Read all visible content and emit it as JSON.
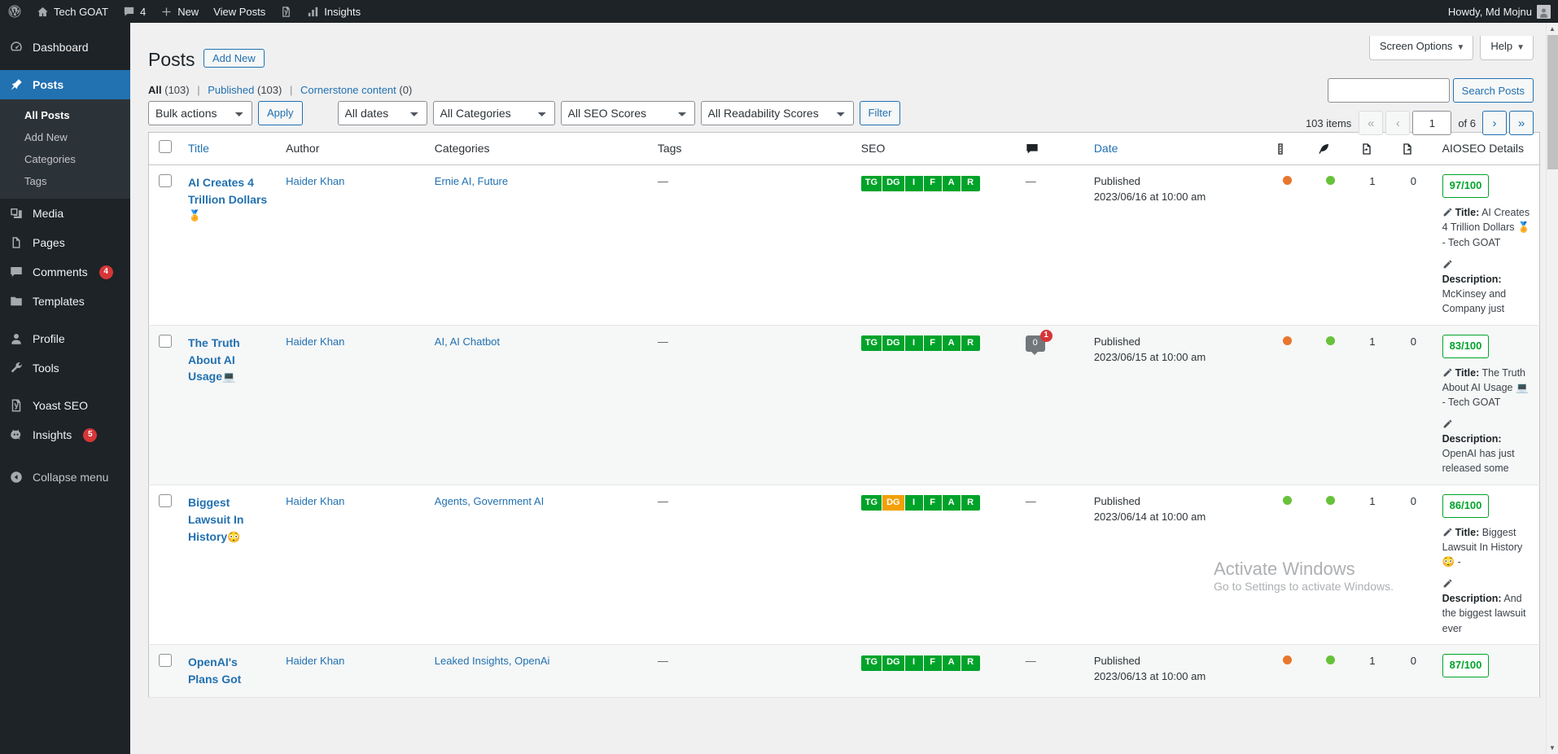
{
  "adminbar": {
    "logo_icon": "wordpress-icon",
    "site_icon": "home-icon",
    "site_name": "Tech GOAT",
    "comments_icon": "comment-icon",
    "comments_count": "4",
    "new_icon": "plus-icon",
    "new_label": "New",
    "view_posts_label": "View Posts",
    "yoast_icon": "yoast-icon",
    "insights_icon": "bar-chart-icon",
    "insights_label": "Insights",
    "howdy": "Howdy, Md Mojnu",
    "avatar_icon": "avatar-icon"
  },
  "sidebar": {
    "items": [
      {
        "label": "Dashboard",
        "icon": "dashboard-icon",
        "current": false
      },
      {
        "label": "Posts",
        "icon": "pin-icon",
        "current": true
      },
      {
        "label": "Media",
        "icon": "media-icon",
        "current": false
      },
      {
        "label": "Pages",
        "icon": "pages-icon",
        "current": false
      },
      {
        "label": "Comments",
        "icon": "comment-icon",
        "current": false,
        "badge": "4"
      },
      {
        "label": "Templates",
        "icon": "folder-icon",
        "current": false
      },
      {
        "label": "Profile",
        "icon": "user-icon",
        "current": false
      },
      {
        "label": "Tools",
        "icon": "wrench-icon",
        "current": false
      },
      {
        "label": "Yoast SEO",
        "icon": "yoast-icon",
        "current": false
      },
      {
        "label": "Insights",
        "icon": "monsterinsights-icon",
        "current": false,
        "badge": "5"
      }
    ],
    "submenu": [
      {
        "label": "All Posts",
        "current": true
      },
      {
        "label": "Add New",
        "current": false
      },
      {
        "label": "Categories",
        "current": false
      },
      {
        "label": "Tags",
        "current": false
      }
    ],
    "collapse_label": "Collapse menu",
    "collapse_icon": "collapse-arrow-icon"
  },
  "screen_meta": {
    "screen_options": "Screen Options",
    "help": "Help",
    "caret": "▼"
  },
  "header": {
    "title": "Posts",
    "add_new": "Add New"
  },
  "views": {
    "all_label": "All",
    "all_count": "(103)",
    "published_label": "Published",
    "published_count": "(103)",
    "cornerstone_label": "Cornerstone content",
    "cornerstone_count": "(0)",
    "separator": "|"
  },
  "filters": {
    "bulk_actions": "Bulk actions",
    "apply": "Apply",
    "all_dates": "All dates",
    "all_categories": "All Categories",
    "all_seo_scores": "All SEO Scores",
    "all_readability_scores": "All Readability Scores",
    "filter": "Filter"
  },
  "search": {
    "value": "",
    "placeholder": "",
    "button": "Search Posts",
    "name": "search-input"
  },
  "pagination": {
    "items_text": "103 items",
    "first": "«",
    "prev": "‹",
    "current_page": "1",
    "of_text": "of 6",
    "next": "›",
    "last": "»"
  },
  "table": {
    "columns": {
      "checkbox": "select-all",
      "title": "Title",
      "author": "Author",
      "categories": "Categories",
      "tags": "Tags",
      "seo": "SEO",
      "comments_icon": "comment-icon",
      "date": "Date",
      "icon1": "readability-icon",
      "icon2": "feather-icon",
      "icon3": "import-page-icon",
      "icon4": "export-page-icon",
      "aioseo": "AIOSEO Details"
    },
    "rows": [
      {
        "title": "AI Creates 4 Trillion Dollars",
        "title_emoji": "🏅",
        "author": "Haider Khan",
        "categories": "Ernie AI, Future",
        "tags": "—",
        "seo_badges": [
          {
            "label": "TG",
            "color": "green"
          },
          {
            "label": "DG",
            "color": "green"
          },
          {
            "label": "I",
            "color": "green"
          },
          {
            "label": "F",
            "color": "green"
          },
          {
            "label": "A",
            "color": "green"
          },
          {
            "label": "R",
            "color": "green"
          }
        ],
        "comments": "—",
        "comment_count": null,
        "comment_badge": null,
        "status": "Published",
        "date": "2023/06/16 at 10:00 am",
        "dot1": "orange",
        "dot2": "green",
        "num1": "1",
        "num2": "0",
        "score": "97/100",
        "aio_title_label": "Title:",
        "aio_title_text": "AI Creates 4 Trillion Dollars 🏅 - Tech GOAT",
        "aio_desc_label": "Description:",
        "aio_desc_text": "McKinsey and Company just released some"
      },
      {
        "title": "The Truth About AI Usage",
        "title_emoji": "💻",
        "author": "Haider Khan",
        "categories": "AI, AI Chatbot",
        "tags": "—",
        "seo_badges": [
          {
            "label": "TG",
            "color": "green"
          },
          {
            "label": "DG",
            "color": "green"
          },
          {
            "label": "I",
            "color": "green"
          },
          {
            "label": "F",
            "color": "green"
          },
          {
            "label": "A",
            "color": "green"
          },
          {
            "label": "R",
            "color": "green"
          }
        ],
        "comments": null,
        "comment_count": "0",
        "comment_badge": "1",
        "status": "Published",
        "date": "2023/06/15 at 10:00 am",
        "dot1": "orange",
        "dot2": "green",
        "num1": "1",
        "num2": "0",
        "score": "83/100",
        "aio_title_label": "Title:",
        "aio_title_text": "The Truth About AI Usage 💻 - Tech GOAT",
        "aio_desc_label": "Description:",
        "aio_desc_text": "OpenAI has just released some"
      },
      {
        "title": "Biggest Lawsuit In History",
        "title_emoji": "😳",
        "author": "Haider Khan",
        "categories": "Agents, Government AI",
        "tags": "—",
        "seo_badges": [
          {
            "label": "TG",
            "color": "green"
          },
          {
            "label": "DG",
            "color": "orange"
          },
          {
            "label": "I",
            "color": "green"
          },
          {
            "label": "F",
            "color": "green"
          },
          {
            "label": "A",
            "color": "green"
          },
          {
            "label": "R",
            "color": "green"
          }
        ],
        "comments": "—",
        "comment_count": null,
        "comment_badge": null,
        "status": "Published",
        "date": "2023/06/14 at 10:00 am",
        "dot1": "green",
        "dot2": "green",
        "num1": "1",
        "num2": "0",
        "score": "86/100",
        "aio_title_label": "Title:",
        "aio_title_text": "Biggest Lawsuit In History 😳 -",
        "aio_desc_label": "Description:",
        "aio_desc_text": "And the biggest lawsuit ever"
      },
      {
        "title": "OpenAI's Plans Got",
        "title_emoji": "",
        "author": "Haider Khan",
        "categories": "Leaked Insights, OpenAi",
        "tags": "—",
        "seo_badges": [
          {
            "label": "TG",
            "color": "green"
          },
          {
            "label": "DG",
            "color": "green"
          },
          {
            "label": "I",
            "color": "green"
          },
          {
            "label": "F",
            "color": "green"
          },
          {
            "label": "A",
            "color": "green"
          },
          {
            "label": "R",
            "color": "green"
          }
        ],
        "comments": "—",
        "comment_count": null,
        "comment_badge": null,
        "status": "Published",
        "date": "2023/06/13 at 10:00 am",
        "dot1": "orange",
        "dot2": "green",
        "num1": "1",
        "num2": "0",
        "score": "87/100",
        "aio_title_label": "",
        "aio_title_text": "",
        "aio_desc_label": "",
        "aio_desc_text": ""
      }
    ]
  },
  "watermark": {
    "line1": "Activate Windows",
    "line2": "Go to Settings to activate Windows."
  },
  "colors": {
    "admin_bg": "#1d2327",
    "accent": "#2271b1",
    "green": "#00a32a",
    "orange": "#f2a006",
    "badge_red": "#d63638"
  }
}
